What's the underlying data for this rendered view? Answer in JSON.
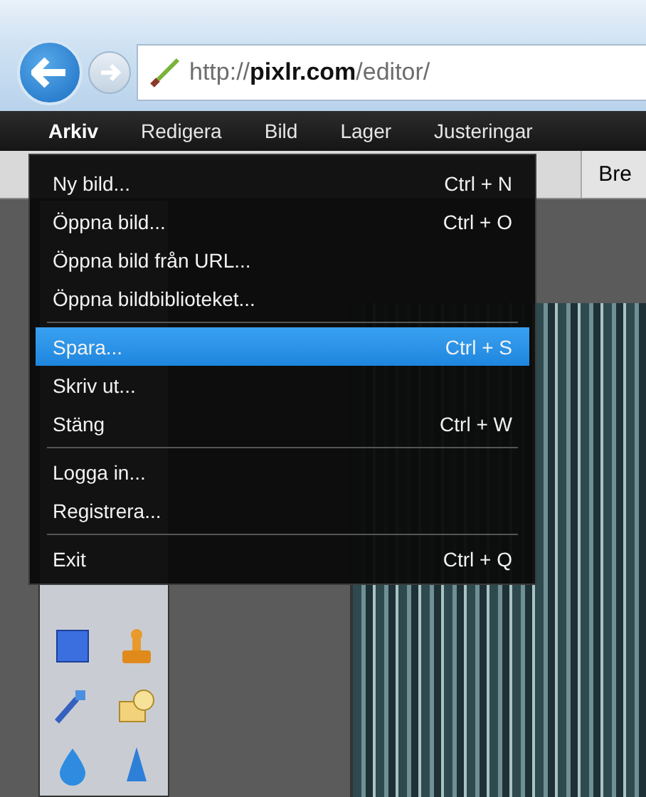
{
  "browser": {
    "url": "http://**pixlr.com**/editor/"
  },
  "menubar": [
    {
      "label": "Arkiv",
      "selected": true
    },
    {
      "label": "Redigera",
      "selected": false
    },
    {
      "label": "Bild",
      "selected": false
    },
    {
      "label": "Lager",
      "selected": false
    },
    {
      "label": "Justeringar",
      "selected": false
    }
  ],
  "toolbar": {
    "button": "Bre"
  },
  "menu": [
    {
      "kind": "item",
      "label": "Ny bild...",
      "shortcut": "Ctrl + N",
      "selected": false
    },
    {
      "kind": "item",
      "label": "Öppna bild...",
      "shortcut": "Ctrl + O",
      "selected": false
    },
    {
      "kind": "item",
      "label": "Öppna bild från URL...",
      "selected": false
    },
    {
      "kind": "item",
      "label": "Öppna bildbiblioteket...",
      "selected": false
    },
    {
      "kind": "separator"
    },
    {
      "kind": "item",
      "label": "Spara...",
      "shortcut": "Ctrl + S",
      "selected": true
    },
    {
      "kind": "item",
      "label": "Skriv ut...",
      "selected": false
    },
    {
      "kind": "item",
      "label": "Stäng",
      "shortcut": "Ctrl + W",
      "selected": false
    },
    {
      "kind": "separator"
    },
    {
      "kind": "item",
      "label": "Logga in...",
      "selected": false
    },
    {
      "kind": "item",
      "label": "Registrera...",
      "selected": false
    },
    {
      "kind": "separator"
    },
    {
      "kind": "item",
      "label": "Exit",
      "shortcut": "Ctrl + Q",
      "selected": false
    }
  ]
}
